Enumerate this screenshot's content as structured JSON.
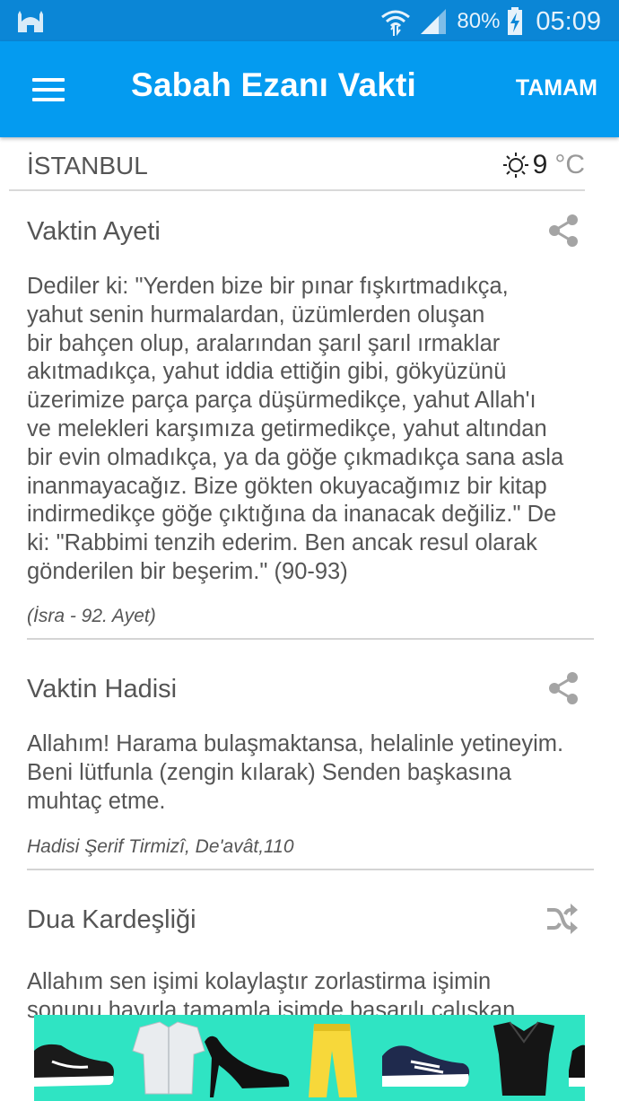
{
  "status_bar": {
    "battery_percent": "80%",
    "time": "05:09",
    "icons": [
      "mosque-icon",
      "wifi-icon",
      "signal-icon",
      "battery-charging-icon"
    ]
  },
  "app_bar": {
    "title": "Sabah Ezanı Vakti",
    "done_label": "TAMAM",
    "menu_icon": "hamburger-menu-icon"
  },
  "location": {
    "city": "İSTANBUL",
    "temperature": "9",
    "unit": "°C",
    "weather_icon": "sun-icon"
  },
  "verse": {
    "title": "Vaktin Ayeti",
    "lines": [
      "Dediler ki: \"Yerden bize bir pınar fışkırtmadıkça,",
      "yahut senin hurmalardan, üzümlerden oluşan",
      "bir bahçen olup, aralarından şarıl şarıl ırmaklar",
      "akıtmadıkça, yahut iddia ettiğin gibi, gökyüzünü",
      "üzerimize parça parça düşürmedikçe, yahut Allah'ı",
      "ve melekleri karşımıza getirmedikçe, yahut altından",
      "bir evin olmadıkça, ya da göğe çıkmadıkça sana asla",
      "inanmayacağız. Bize gökten okuyacağımız bir kitap",
      "indirmedikçe göğe çıktığına da inanacak değiliz.\" De",
      "ki: \"Rabbimi tenzih ederim. Ben ancak resul olarak",
      "gönderilen bir beşerim.\" (90-93)"
    ],
    "source": "(İsra - 92. Ayet)",
    "action_icon": "share-icon"
  },
  "hadith": {
    "title": "Vaktin Hadisi",
    "lines": [
      "Allahım! Harama bulaşmaktansa, helalinle yetineyim.",
      "Beni lütfunla (zengin kılarak) Senden başkasına",
      "muhtaç etme."
    ],
    "source": "Hadisi Şerif  Tirmizî, De'avât,110",
    "action_icon": "share-icon"
  },
  "prayer": {
    "title": "Dua Kardeşliği",
    "lines": [
      "Allahım sen işimi kolaylaştır zorlastirma işimin",
      "sonunu hayırla tamamla işimde başarılı çalışkan"
    ],
    "action_icon": "shuffle-icon"
  },
  "colors": {
    "status_bar": "#0b86d6",
    "app_bar": "#049bf0",
    "ad_background": "#2fe4c3"
  }
}
